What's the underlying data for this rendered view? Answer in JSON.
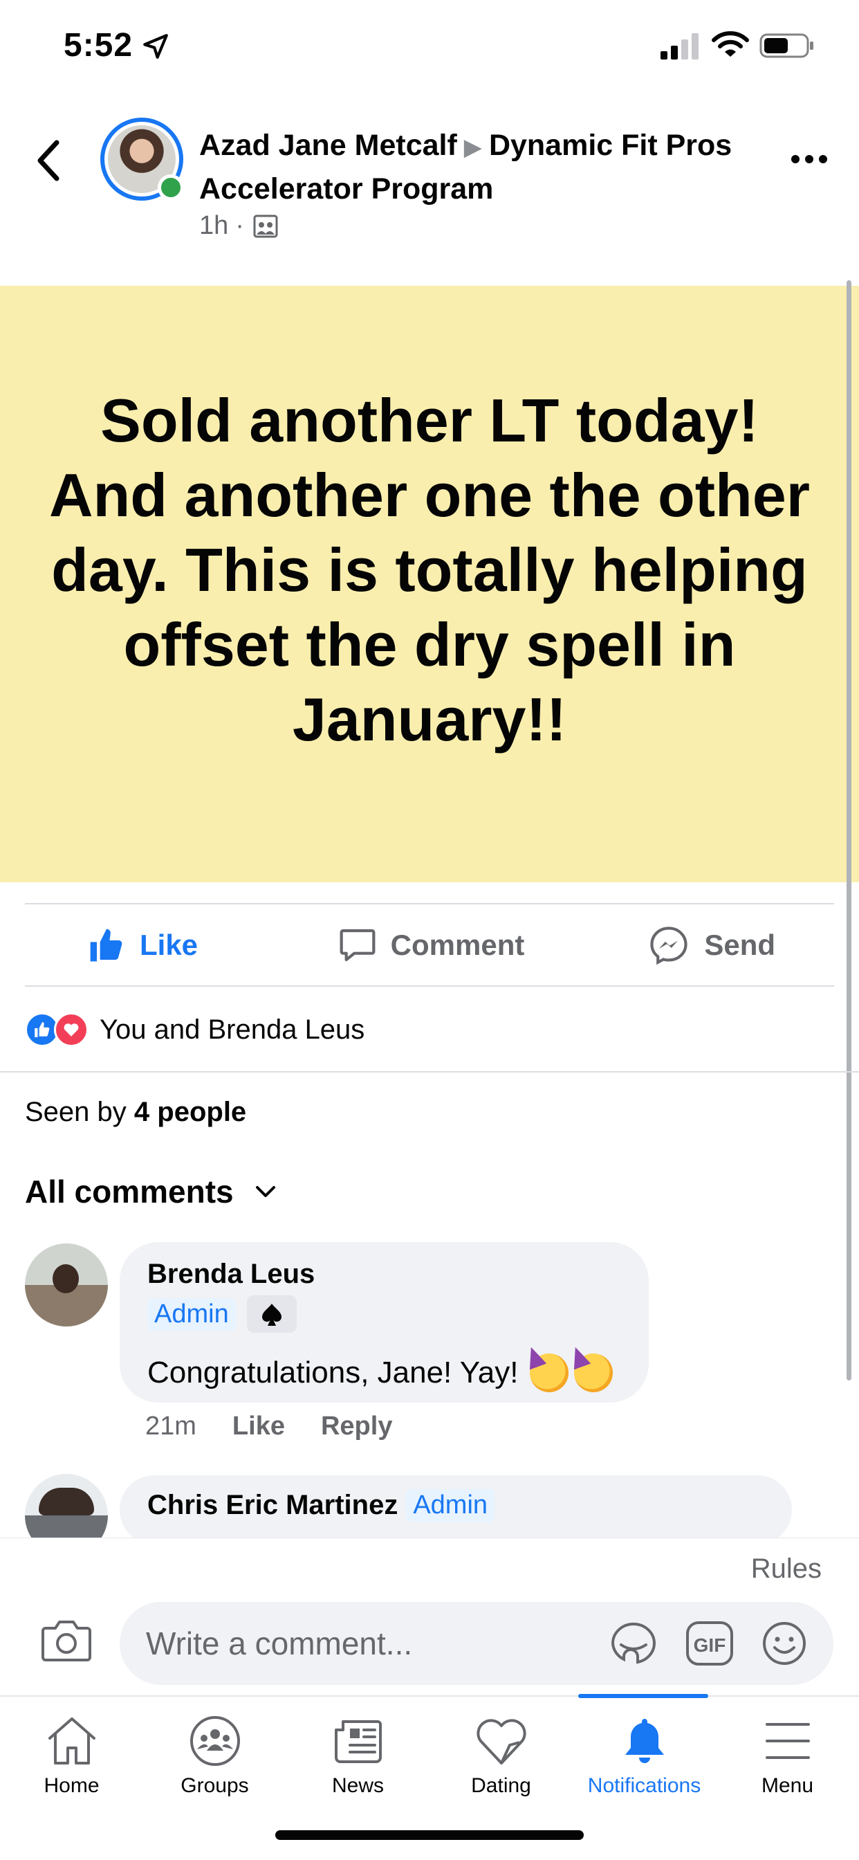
{
  "status_bar": {
    "time": "5:52"
  },
  "post": {
    "author": "Azad Jane Metcalf",
    "group": "Dynamic Fit Pros Accelerator Program",
    "time_ago": "1h",
    "meta_separator": "·",
    "body": "Sold another LT today! And another one the other day. This is totally helping offset the dry spell in January!!",
    "background_color": "#f9eeae"
  },
  "actions": {
    "like": "Like",
    "comment": "Comment",
    "send": "Send"
  },
  "reactions": {
    "text": "You and Brenda Leus"
  },
  "seen": {
    "prefix": "Seen by",
    "count": "4 people"
  },
  "comments_header": "All comments",
  "comments": [
    {
      "name": "Brenda Leus",
      "badge": "Admin",
      "text": "Congratulations, Jane! Yay!",
      "time": "21m",
      "like": "Like",
      "reply": "Reply"
    },
    {
      "name": "Chris Eric Martinez",
      "badge": "Admin"
    }
  ],
  "composer": {
    "rules": "Rules",
    "placeholder": "Write a comment...",
    "gif": "GIF"
  },
  "tabs": [
    {
      "label": "Home",
      "icon": "home-icon"
    },
    {
      "label": "Groups",
      "icon": "groups-icon"
    },
    {
      "label": "News",
      "icon": "news-icon"
    },
    {
      "label": "Dating",
      "icon": "dating-icon"
    },
    {
      "label": "Notifications",
      "icon": "bell-icon",
      "active": true
    },
    {
      "label": "Menu",
      "icon": "menu-icon"
    }
  ],
  "colors": {
    "accent": "#1877f2",
    "secondary_text": "#65676b",
    "bubble": "#f0f2f5"
  }
}
